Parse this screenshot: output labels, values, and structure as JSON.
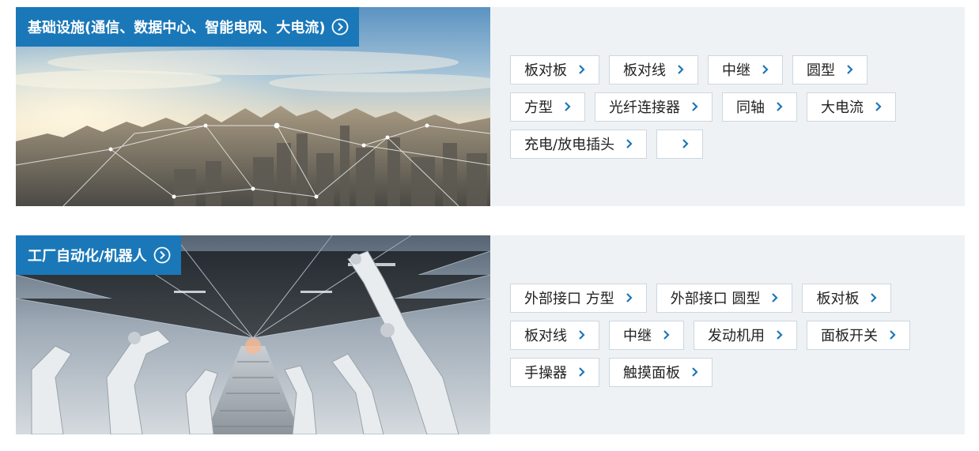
{
  "sections": [
    {
      "title": "基础设施(通信、数据中心、智能电网、大电流)",
      "tags": [
        "板对板",
        "板对线",
        "中继",
        "圆型",
        "方型",
        "光纤连接器",
        "同轴",
        "大电流",
        "充电/放电插头",
        ""
      ]
    },
    {
      "title": "工厂自动化/机器人",
      "tags": [
        "外部接口 方型",
        "外部接口 圆型",
        "板对板",
        "板对线",
        "中继",
        "发动机用",
        "面板开关",
        "手操器",
        "触摸面板"
      ]
    }
  ],
  "colors": {
    "accent": "#1a78b9",
    "panel": "#eef2f5",
    "chevron": "#1a78b9"
  },
  "icons": {
    "title_arrow": "circle-arrow-right-icon",
    "tag_arrow": "chevron-right-icon"
  }
}
